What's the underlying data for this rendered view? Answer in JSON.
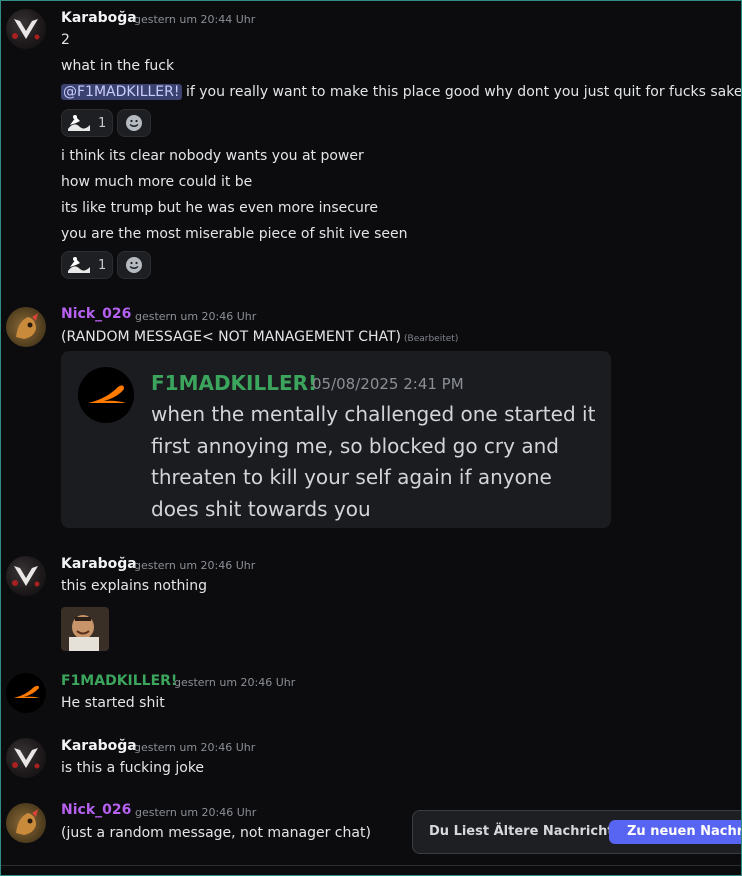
{
  "colors": {
    "background": "#0c0c0e",
    "karaboga_name": "#f2f3f5",
    "nick_name": "#b660f0",
    "f1_name": "#3ba55d",
    "accent": "#5865f2"
  },
  "groups": [
    {
      "user": "Karaboğa",
      "timestamp": "gestern um 20:44 Uhr",
      "lines": [
        "2",
        "what in the fuck"
      ],
      "mention": "@F1MADKILLER!",
      "mention_rest": " if you really want to make this place good why dont you just quit for fucks sake",
      "reaction1_count": "1",
      "lines2": [
        "i think its clear nobody wants you at power",
        "how much more could it be",
        "its like trump but he was even more insecure",
        "you are the most miserable piece of shit ive seen"
      ],
      "reaction2_count": "1"
    },
    {
      "user": "Nick_026",
      "timestamp": "gestern um 20:46 Uhr",
      "text": "(RANDOM MESSAGE< NOT MANAGEMENT CHAT)",
      "edited": "(Bearbeitet)",
      "quote": {
        "author": "F1MADKILLER!",
        "date": "05/08/2025 2:41 PM",
        "text": "when the mentally challenged one started it first annoying me, so blocked go cry and threaten to kill your self again if anyone does shit towards you"
      }
    },
    {
      "user": "Karaboğa",
      "timestamp": "gestern um 20:46 Uhr",
      "text": "this explains nothing"
    },
    {
      "user": "F1MADKILLER!",
      "timestamp": "gestern um 20:46 Uhr",
      "text": "He started shit"
    },
    {
      "user": "Karaboğa",
      "timestamp": "gestern um 20:46 Uhr",
      "text": "is this a fucking joke"
    },
    {
      "user": "Nick_026",
      "timestamp": "gestern um 20:46 Uhr",
      "text": "(just a random message, not manager chat)"
    }
  ],
  "banner": {
    "text": "Du Liest Ältere Nachrichten",
    "button": "Zu neuen Nachricht"
  }
}
